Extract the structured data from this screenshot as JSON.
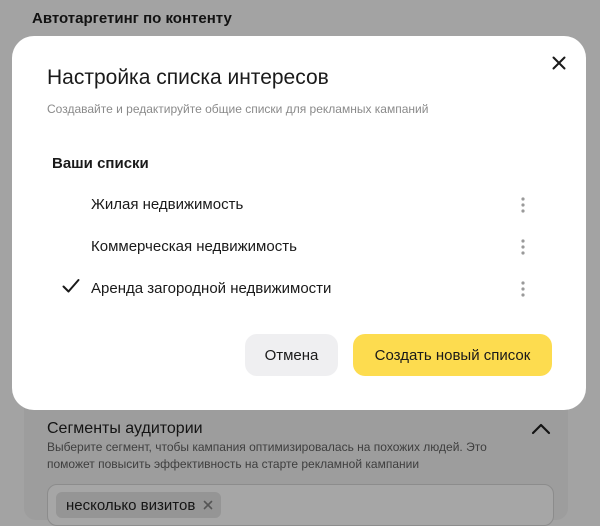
{
  "background": {
    "heading": "Автотаргетинг по контенту",
    "segments": {
      "title": "Сегменты аудитории",
      "description": "Выберите сегмент, чтобы кампания оптимизировалась на похожих людей. Это поможет повысить эффективность на старте рекламной кампании",
      "chip_label": "несколько визитов"
    }
  },
  "modal": {
    "title": "Настройка списка интересов",
    "subtitle": "Создавайте и редактируйте общие списки для рекламных кампаний",
    "section_title": "Ваши списки",
    "lists": [
      {
        "label": "Жилая недвижимость",
        "checked": false
      },
      {
        "label": "Коммерческая недвижимость",
        "checked": false
      },
      {
        "label": "Аренда загородной недвижимости",
        "checked": true
      }
    ],
    "cancel_label": "Отмена",
    "create_label": "Создать новый список"
  },
  "icons": {
    "close": "close-icon",
    "check": "check-icon",
    "more": "more-vertical-icon",
    "chevron": "chevron-up-icon",
    "chip_remove": "close-icon"
  },
  "colors": {
    "accent": "#fddc4f",
    "secondary_button": "#efeff1",
    "overlay": "#a3a3a3"
  }
}
